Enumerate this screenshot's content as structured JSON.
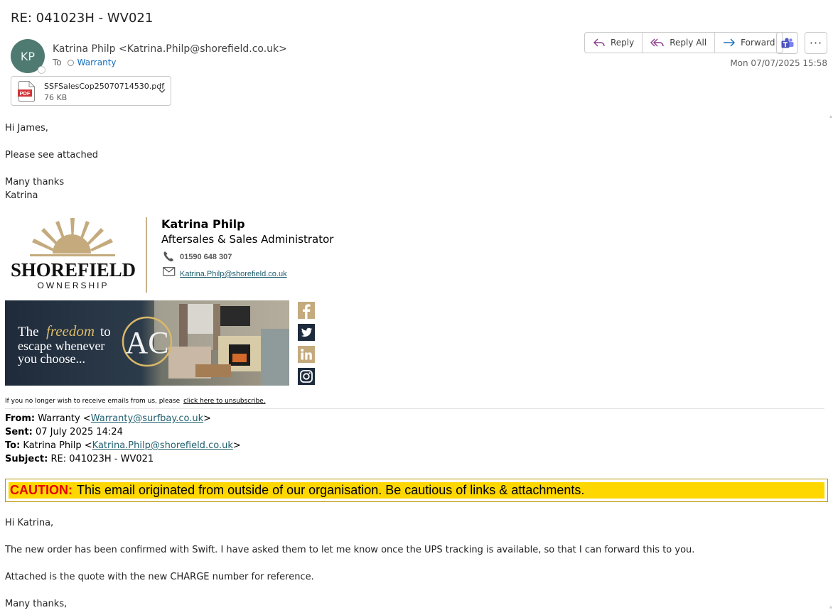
{
  "email": {
    "subject": "RE: 041023H - WV021",
    "avatar_initials": "KP",
    "sender": "Katrina Philp <Katrina.Philp@shorefield.co.uk>",
    "to_label": "To",
    "recipient": "Warranty",
    "date": "Mon 07/07/2025 15:58"
  },
  "toolbar": {
    "reply": "Reply",
    "reply_all": "Reply All",
    "forward": "Forward",
    "more": "···"
  },
  "attachment": {
    "name": "SSFSalesCop25070714530.pdf",
    "size": "76 KB",
    "icon_label": "PDF"
  },
  "body": {
    "greeting": "Hi James,",
    "line1": "Please see attached",
    "signoff1": "Many thanks",
    "signoff2": "Katrina"
  },
  "signature": {
    "logo_text": "SHOREFIELD",
    "logo_sub": "OWNERSHIP",
    "name": "Katrina Philp",
    "title": "Aftersales & Sales Administrator",
    "phone": "01590 648 307",
    "email": "Katrina.Philp@shorefield.co.uk",
    "banner_line1_a": "The",
    "banner_line1_b": "freedom",
    "banner_line1_c": "to",
    "banner_line2": "escape whenever",
    "banner_line3": "you choose...",
    "banner_logo": "AC",
    "social_icons": [
      "facebook-icon",
      "twitter-icon",
      "linkedin-icon",
      "instagram-icon"
    ],
    "unsubscribe_text": "If you no longer wish to receive emails from us, please",
    "unsubscribe_link": "click here to unsubscribe."
  },
  "quoted": {
    "from_label": "From:",
    "from_name": "Warranty <",
    "from_email": "Warranty@surfbay.co.uk",
    "from_close": ">",
    "sent_label": "Sent:",
    "sent_value": "07 July 2025 14:24",
    "to_label": "To:",
    "to_name": "Katrina Philp <",
    "to_email": "Katrina.Philp@shorefield.co.uk",
    "to_close": ">",
    "subject_label": "Subject:",
    "subject_value": "RE: 041023H - WV021",
    "caution_label": "CAUTION:",
    "caution_text": "This email originated from outside of our organisation. Be cautious of links & attachments.",
    "greeting": "Hi Katrina,",
    "para1": "The new order has been confirmed with Swift. I have asked them to let me know once the UPS tracking is available, so that I can forward this to you.",
    "para2": "Attached is the quote with the new CHARGE number for reference.",
    "signoff": "Many thanks,"
  },
  "colors": {
    "accent": "#0f6cbd",
    "avatar": "#4f7a72",
    "brand_gold": "#c7b08b",
    "caution_bg": "#ffd700",
    "caution_label": "#e60000"
  }
}
